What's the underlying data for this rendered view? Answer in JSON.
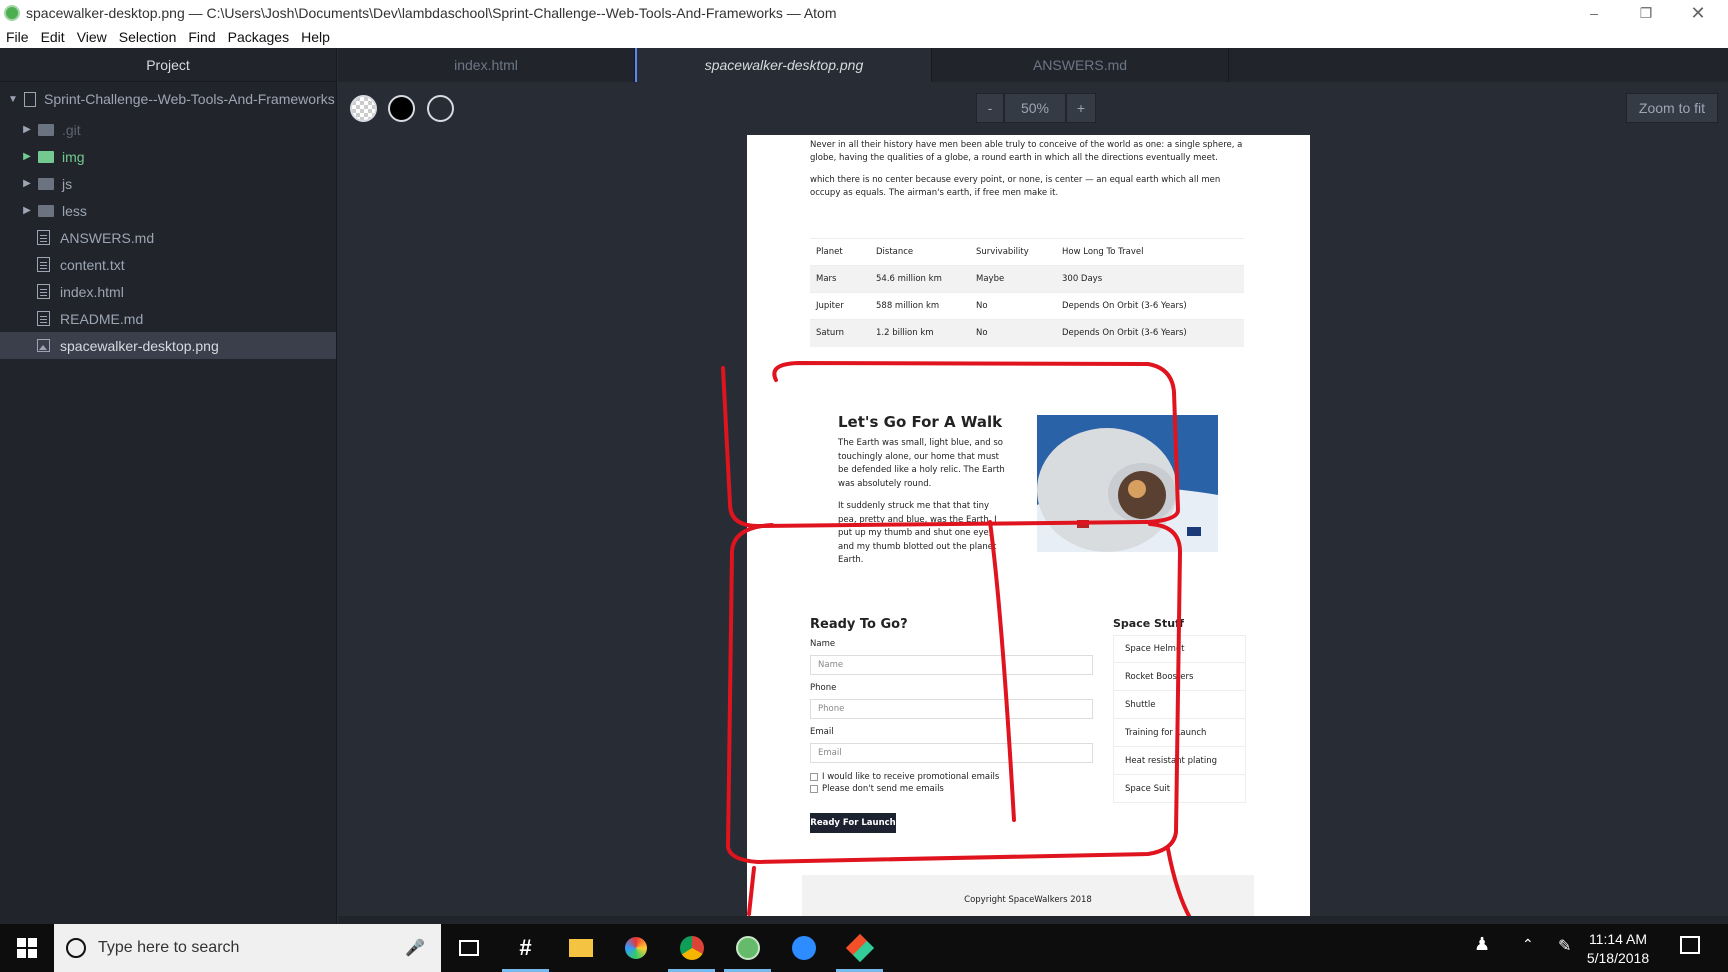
{
  "window": {
    "title": "spacewalker-desktop.png — C:\\Users\\Josh\\Documents\\Dev\\lambdaschool\\Sprint-Challenge--Web-Tools-And-Frameworks — Atom"
  },
  "menu": [
    "File",
    "Edit",
    "View",
    "Selection",
    "Find",
    "Packages",
    "Help"
  ],
  "sidebar": {
    "header": "Project",
    "root": "Sprint-Challenge--Web-Tools-And-Frameworks",
    "items": [
      ".git",
      "img",
      "js",
      "less",
      "ANSWERS.md",
      "content.txt",
      "index.html",
      "README.md",
      "spacewalker-desktop.png"
    ]
  },
  "tabs": [
    "index.html",
    "spacewalker-desktop.png",
    "ANSWERS.md"
  ],
  "toolbar": {
    "zoom_minus": "-",
    "zoom_level": "50%",
    "zoom_plus": "+",
    "zoom_fit": "Zoom to fit"
  },
  "page": {
    "intro": [
      "Never in all their history have men been able truly to conceive of the world as one: a single sphere, a globe, having the qualities of a globe, a round earth in which all the directions eventually meet.",
      "which there is no center because every point, or none, is center — an equal earth which all men occupy as equals. The airman's earth, if free men make it."
    ],
    "table": {
      "headers": [
        "Planet",
        "Distance",
        "Survivability",
        "How Long To Travel"
      ],
      "rows": [
        [
          "Mars",
          "54.6 million km",
          "Maybe",
          "300 Days"
        ],
        [
          "Jupiter",
          "588 million km",
          "No",
          "Depends On Orbit (3-6 Years)"
        ],
        [
          "Saturn",
          "1.2 billion km",
          "No",
          "Depends On Orbit (3-6 Years)"
        ]
      ]
    },
    "walk": {
      "title": "Let's Go For A Walk",
      "p1": "The Earth was small, light blue, and so touchingly alone, our home that must be defended like a holy relic. The Earth was absolutely round.",
      "p2": "It suddenly struck me that that tiny pea, pretty and blue, was the Earth. I put up my thumb and shut one eye, and my thumb blotted out the planet Earth."
    },
    "form": {
      "title": "Ready To Go?",
      "name_label": "Name",
      "name_placeholder": "Name",
      "phone_label": "Phone",
      "phone_placeholder": "Phone",
      "email_label": "Email",
      "email_placeholder": "Email",
      "check1": "I would like to receive promotional emails",
      "check2": "Please don't send me emails",
      "button": "Ready For Launch"
    },
    "stuff": {
      "title": "Space Stuff",
      "items": [
        "Space Helmet",
        "Rocket Boosters",
        "Shuttle",
        "Training for Launch",
        "Heat resistant plating",
        "Space Suit"
      ]
    },
    "footer": "Copyright SpaceWalkers 2018"
  },
  "taskbar": {
    "search_placeholder": "Type here to search",
    "time": "11:14 AM",
    "date": "5/18/2018"
  },
  "colors": {
    "annotation": "#e0141e",
    "accent": "#568af2"
  }
}
